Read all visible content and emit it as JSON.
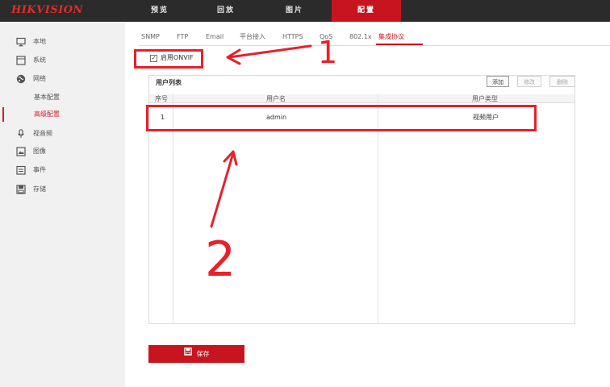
{
  "header": {
    "logo": "HIKVISION",
    "nav": [
      "预览",
      "回放",
      "图片",
      "配置"
    ],
    "active_nav": "配置"
  },
  "sidebar": {
    "items": [
      {
        "label": "本地",
        "icon": "monitor-icon"
      },
      {
        "label": "系统",
        "icon": "system-icon"
      },
      {
        "label": "网络",
        "icon": "network-globe-icon"
      },
      {
        "label": "视音频",
        "icon": "microphone-icon"
      },
      {
        "label": "图像",
        "icon": "image-icon"
      },
      {
        "label": "事件",
        "icon": "event-calendar-icon"
      },
      {
        "label": "存储",
        "icon": "storage-disk-icon"
      }
    ],
    "network_sub": [
      "基本配置",
      "高级配置"
    ],
    "active_sub": "高级配置"
  },
  "tabs": [
    "SNMP",
    "FTP",
    "Email",
    "平台接入",
    "HTTPS",
    "QoS",
    "802.1x",
    "集成协议"
  ],
  "active_tab": "集成协议",
  "onvif": {
    "checked": true,
    "label": "启用ONVIF"
  },
  "user_list": {
    "title": "用户列表",
    "buttons": {
      "add": "添加",
      "edit": "修改",
      "delete": "删除"
    },
    "columns": [
      "序号",
      "用户名",
      "用户类型"
    ],
    "rows": [
      {
        "index": "1",
        "username": "admin",
        "type": "视频用户"
      }
    ]
  },
  "save_label": "保存",
  "annotations": {
    "mark1": "1",
    "mark2": "2"
  },
  "colors": {
    "accent": "#c8141e",
    "annotation": "#e8202a",
    "topbar": "#2b2b2b"
  }
}
